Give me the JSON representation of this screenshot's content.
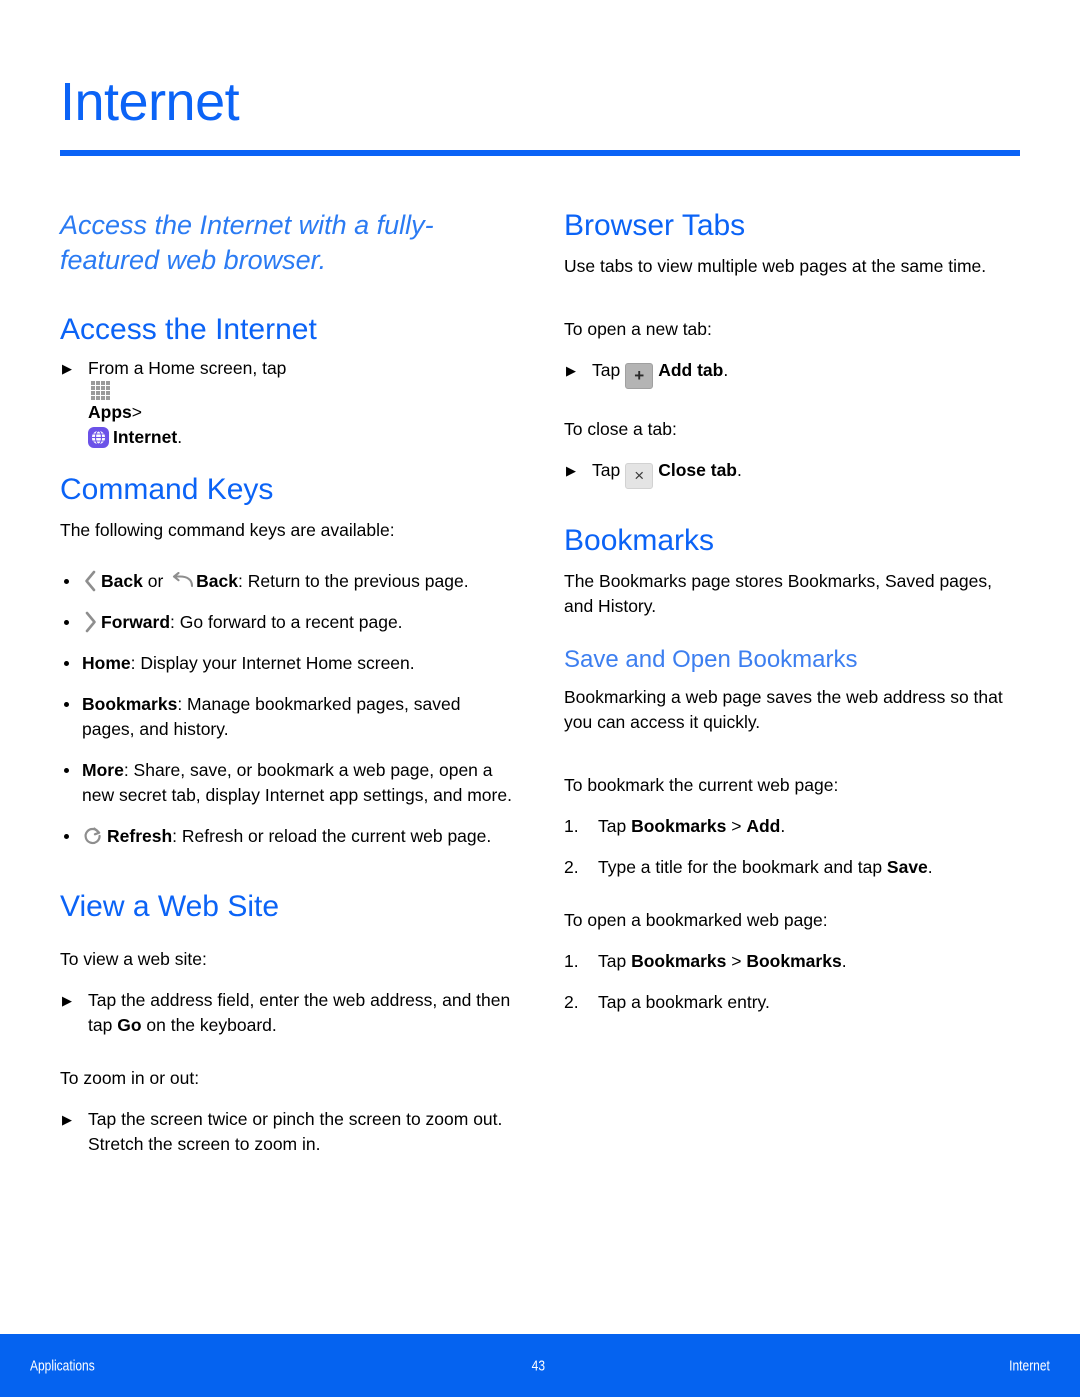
{
  "page": {
    "title": "Internet",
    "lead": "Access the Internet with a fully-featured web browser."
  },
  "colors": {
    "heading_blue": "#0b63f6",
    "sub_blue": "#3d7ff0",
    "lead_blue": "#2b7bf3",
    "footer_blue": "#0563f0",
    "app_icon_purple": "#6b52e8",
    "icon_gray": "#9a9a9a"
  },
  "left_column": {
    "access": {
      "heading": "Access the Internet",
      "step_prefix": "From a Home screen, tap",
      "apps_label": "Apps",
      "separator": ">",
      "internet_label": "Internet",
      "period": "."
    },
    "command_keys": {
      "heading": "Command Keys",
      "intro": "The following command keys are available:",
      "items": [
        {
          "icons": [
            "chevron-left-icon",
            "back-curl-icon"
          ],
          "term": "Back",
          "conjunction": "or",
          "term2": "Back",
          "text": ": Return to the previous page."
        },
        {
          "icons": [
            "chevron-right-icon"
          ],
          "term": "Forward",
          "text": ": Go forward to a recent page."
        },
        {
          "icons": [],
          "term": "Home",
          "text": ": Display your Internet Home screen."
        },
        {
          "icons": [],
          "term": "Bookmarks",
          "text": ": Manage bookmarked pages, saved pages, and history."
        },
        {
          "icons": [],
          "term": "More",
          "text": ": Share, save, or bookmark a web page, open a new secret tab, display Internet app settings, and more."
        },
        {
          "icons": [
            "refresh-icon"
          ],
          "term": "Refresh",
          "text": ": Refresh or reload the current web page."
        }
      ]
    },
    "view_web_site": {
      "heading": "View a Web Site",
      "intro1": "To view a web site:",
      "step1_a": "Tap the address field, enter the web address, and then tap ",
      "step1_b": "Go",
      "step1_c": " on the keyboard.",
      "intro2": "To zoom in or out:",
      "step2": "Tap the screen twice or pinch the screen to zoom out. Stretch the screen to zoom in."
    }
  },
  "right_column": {
    "browser_tabs": {
      "heading": "Browser Tabs",
      "intro": "Use tabs to view multiple web pages at the same time.",
      "open_label": "To open a new tab:",
      "open_tap": "Tap",
      "add_key": "+",
      "add_label": "Add tab",
      "close_label": "To close a tab:",
      "close_tap": "Tap",
      "close_key": "×",
      "close_action": "Close tab",
      "period": "."
    },
    "bookmarks": {
      "heading": "Bookmarks",
      "intro": "The Bookmarks page stores Bookmarks, Saved pages, and History.",
      "sub_heading": "Save and Open Bookmarks",
      "sub_intro": "Bookmarking a web page saves the web address so that you can access it quickly.",
      "to_bookmark_label": "To bookmark the current web page:",
      "bookmark_steps": [
        {
          "num": "1.",
          "a": "Tap ",
          "b": "Bookmarks",
          "c": " > ",
          "d": "Add",
          "e": "."
        },
        {
          "num": "2.",
          "a": "Type a title for the bookmark and tap ",
          "b": "Save",
          "c": "."
        }
      ],
      "to_open_label": "To open a bookmarked web page:",
      "open_steps": [
        {
          "num": "1.",
          "a": "Tap ",
          "b": "Bookmarks",
          "c": " > ",
          "d": "Bookmarks",
          "e": "."
        },
        {
          "num": "2.",
          "a": "Tap a bookmark entry.",
          "b": "",
          "c": ""
        }
      ]
    }
  },
  "footer": {
    "left": "Applications",
    "center": "43",
    "right": "Internet"
  }
}
